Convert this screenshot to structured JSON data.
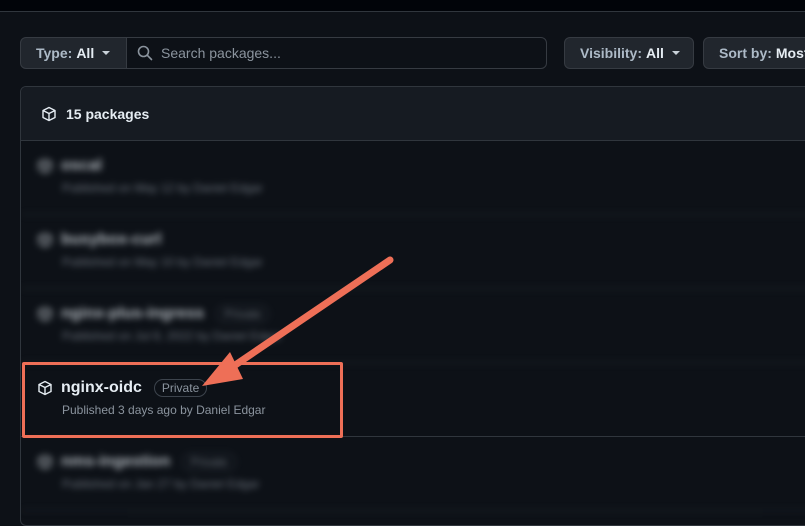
{
  "filters": {
    "type_label": "Type:",
    "type_value": "All",
    "search_placeholder": "Search packages...",
    "visibility_label": "Visibility:",
    "visibility_value": "All",
    "sort_label": "Sort by:",
    "sort_value": "Most"
  },
  "list": {
    "count_label": "15 packages",
    "packages": [
      {
        "name": "oscal",
        "subtitle": "Published on May 12 by Daniel Edgar",
        "badge": "",
        "blurred": true
      },
      {
        "name": "busybox-curl",
        "subtitle": "Published on May 10 by Daniel Edgar",
        "badge": "",
        "blurred": true
      },
      {
        "name": "nginx-plus-ingress",
        "subtitle": "Published on Jul 8, 2022 by Daniel Edgar",
        "badge": "Private",
        "blurred": true
      },
      {
        "name": "nginx-oidc",
        "subtitle": "Published 3 days ago by Daniel Edgar",
        "badge": "Private",
        "blurred": false
      },
      {
        "name": "nms-ingestion",
        "subtitle": "Published on Jan 27 by Daniel Edgar",
        "badge": "Private",
        "blurred": true
      }
    ]
  },
  "annotation": {
    "highlight_color": "#ee6f57"
  }
}
